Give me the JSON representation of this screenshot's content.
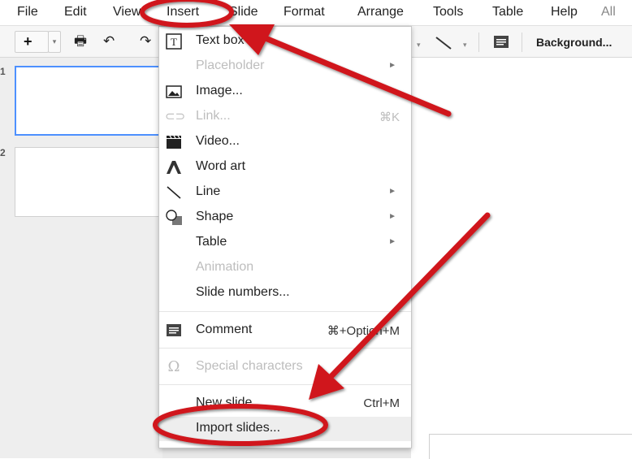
{
  "menubar": {
    "items": [
      "File",
      "Edit",
      "View",
      "Insert",
      "Slide",
      "Format",
      "Arrange",
      "Tools",
      "Table",
      "Help",
      "All"
    ]
  },
  "toolbar": {
    "new_label": "+",
    "background_label": "Background..."
  },
  "filmstrip": {
    "slides": [
      {
        "number": "1"
      },
      {
        "number": "2"
      }
    ]
  },
  "insert_menu": {
    "items": [
      {
        "label": "Text box",
        "icon": "text-box-icon"
      },
      {
        "label": "Placeholder",
        "disabled": true,
        "submenu": true
      },
      {
        "label": "Image...",
        "icon": "image-icon"
      },
      {
        "label": "Link...",
        "icon": "link-icon",
        "shortcut": "⌘K",
        "disabled": true
      },
      {
        "label": "Video...",
        "icon": "video-icon"
      },
      {
        "label": "Word art",
        "icon": "word-art-icon"
      },
      {
        "label": "Line",
        "icon": "line-icon",
        "submenu": true
      },
      {
        "label": "Shape",
        "icon": "shape-icon",
        "submenu": true
      },
      {
        "label": "Table",
        "submenu": true
      },
      {
        "label": "Animation",
        "disabled": true
      },
      {
        "label": "Slide numbers..."
      },
      {
        "label": "Comment",
        "icon": "comment-icon",
        "shortcut": "⌘+Option+M"
      },
      {
        "label": "Special characters",
        "icon": "omega-icon",
        "disabled": true
      },
      {
        "label": "New slide",
        "shortcut": "Ctrl+M"
      },
      {
        "label": "Import slides...",
        "highlighted": true
      }
    ]
  },
  "annotation_color": "#d0131a"
}
